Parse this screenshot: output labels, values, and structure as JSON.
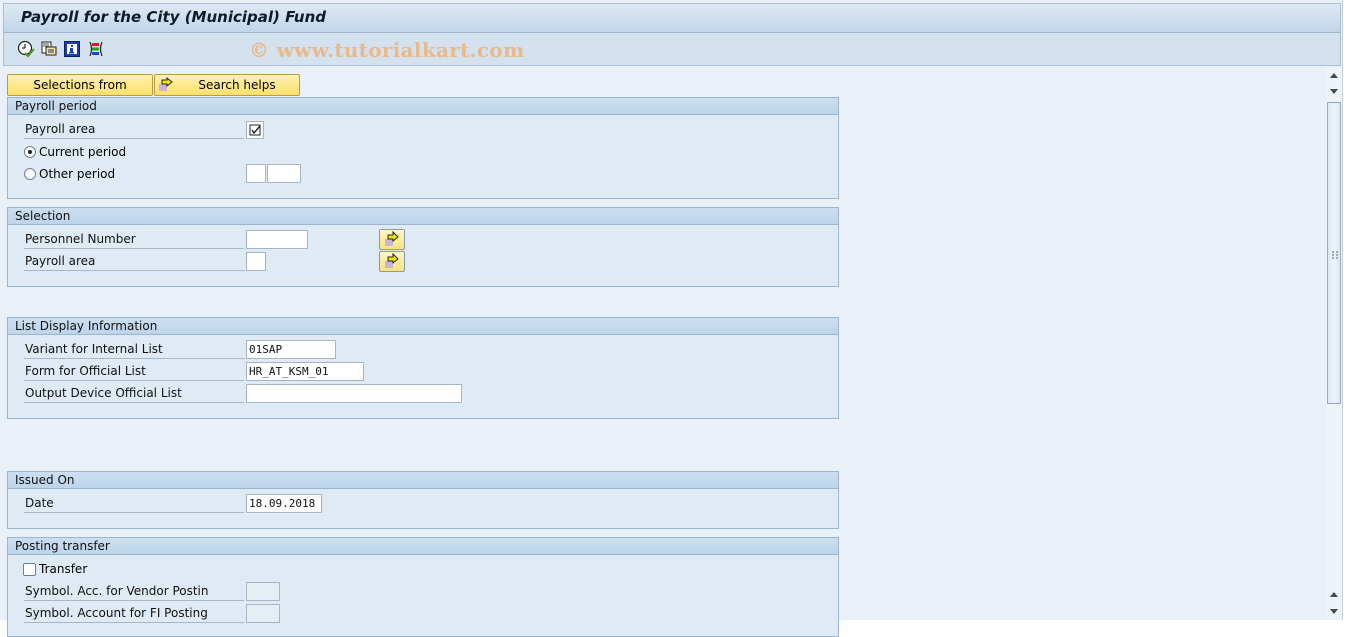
{
  "window": {
    "title": "Payroll for the City (Municipal) Fund",
    "watermark": "© www.tutorialkart.com"
  },
  "toolbar": {
    "icons": [
      "execute-icon",
      "get-variant-icon",
      "program-documentation-icon",
      "selection-options-icon"
    ]
  },
  "buttons": {
    "selections_from": "Selections from",
    "search_helps": "Search helps"
  },
  "groups": {
    "payroll_period": {
      "title": "Payroll period",
      "payroll_area_label": "Payroll area",
      "payroll_area_checked": true,
      "current_period_label": "Current period",
      "current_period_selected": true,
      "other_period_label": "Other period",
      "other_period_selected": false,
      "other_period_value1": "",
      "other_period_value2": ""
    },
    "selection": {
      "title": "Selection",
      "personnel_number_label": "Personnel Number",
      "personnel_number_value": "",
      "payroll_area_label": "Payroll area",
      "payroll_area_value": ""
    },
    "list_display": {
      "title": "List Display Information",
      "variant_label": "Variant for Internal List",
      "variant_value": "01SAP",
      "form_label": "Form for Official List",
      "form_value": "HR_AT_KSM_01",
      "output_device_label": "Output Device Official List",
      "output_device_value": ""
    },
    "issued_on": {
      "title": "Issued On",
      "date_label": "Date",
      "date_value": "18.09.2018"
    },
    "posting_transfer": {
      "title": "Posting transfer",
      "transfer_label": "Transfer",
      "transfer_checked": false,
      "vendor_label": "Symbol. Acc. for Vendor Postin",
      "vendor_value": "",
      "fi_label": "Symbol. Account for FI Posting",
      "fi_value": ""
    }
  }
}
